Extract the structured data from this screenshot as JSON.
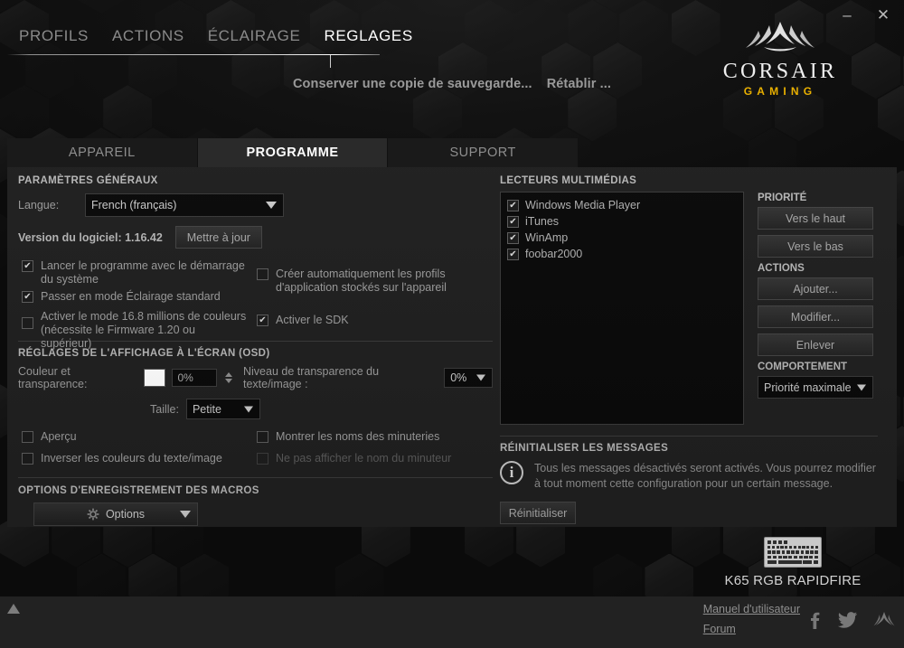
{
  "window": {
    "minimize_label": "–",
    "close_label": "✕"
  },
  "brand": {
    "name": "CORSAIR",
    "tagline": "GAMING"
  },
  "topnav": {
    "items": [
      {
        "label": "PROFILS",
        "active": false
      },
      {
        "label": "ACTIONS",
        "active": false
      },
      {
        "label": "ÉCLAIRAGE",
        "active": false
      },
      {
        "label": "REGLAGES",
        "active": true
      }
    ]
  },
  "subactions": [
    {
      "label": "Conserver une copie de sauvegarde..."
    },
    {
      "label": "Rétablir ..."
    }
  ],
  "tabs": [
    {
      "label": "APPAREIL",
      "active": false
    },
    {
      "label": "PROGRAMME",
      "active": true
    },
    {
      "label": "SUPPORT",
      "active": false
    }
  ],
  "general": {
    "section_title": "PARAMÈTRES GÉNÉRAUX",
    "language_label": "Langue:",
    "language_value": "French (français)",
    "version_label": "Version du logiciel: 1.16.42",
    "update_button": "Mettre à jour",
    "checkboxes": [
      {
        "label": "Lancer le programme avec le démarrage du système",
        "checked": true,
        "disabled": false
      },
      {
        "label": "Créer automatiquement les profils d'application stockés sur l'appareil",
        "checked": false,
        "disabled": false
      },
      {
        "label": "Passer en mode Éclairage standard",
        "checked": true,
        "disabled": false
      },
      {
        "label": "Activer le mode 16.8 millions de couleurs (nécessite le Firmware 1.20 ou supérieur)",
        "checked": false,
        "disabled": false
      },
      {
        "label": "Activer le SDK",
        "checked": true,
        "disabled": false
      }
    ]
  },
  "osd": {
    "section_title": "RÉGLAGES DE L'AFFICHAGE À L'ÉCRAN (OSD)",
    "color_label": "Couleur et transparence:",
    "color_value": "#ffffff",
    "transparency_value": "0%",
    "text_transparency_label": "Niveau de transparence du texte/image :",
    "text_transparency_value": "0%",
    "size_label": "Taille:",
    "size_value": "Petite",
    "checkboxes": [
      {
        "label": "Aperçu",
        "checked": false,
        "disabled": false
      },
      {
        "label": "Montrer les noms des minuteries",
        "checked": false,
        "disabled": false
      },
      {
        "label": "Inverser les couleurs du texte/image",
        "checked": false,
        "disabled": false
      },
      {
        "label": "Ne pas afficher le nom du minuteur",
        "checked": false,
        "disabled": true
      }
    ]
  },
  "macros": {
    "section_title": "OPTIONS D'ENREGISTREMENT DES MACROS",
    "options_button": "Options"
  },
  "media": {
    "section_title": "LECTEURS MULTIMÉDIAS",
    "players": [
      {
        "label": "Windows Media Player",
        "checked": true
      },
      {
        "label": "iTunes",
        "checked": true
      },
      {
        "label": "WinAmp",
        "checked": true
      },
      {
        "label": "foobar2000",
        "checked": true
      }
    ],
    "priority_title": "PRIORITÉ",
    "priority_buttons": [
      "Vers le haut",
      "Vers le bas"
    ],
    "actions_title": "ACTIONS",
    "action_buttons": [
      "Ajouter...",
      "Modifier...",
      "Enlever"
    ],
    "behavior_title": "COMPORTEMENT",
    "behavior_value": "Priorité maximale"
  },
  "reset": {
    "section_title": "RÉINITIALISER LES MESSAGES",
    "description": "Tous les messages désactivés seront activés. Vous pourrez modifier à tout moment cette configuration pour un certain message.",
    "button": "Réinitialiser"
  },
  "device": {
    "name": "K65 RGB RAPIDFIRE"
  },
  "footer": {
    "links": [
      {
        "label": "Manuel d'utilisateur"
      },
      {
        "label": "Forum"
      }
    ],
    "social": [
      "facebook-icon",
      "twitter-icon",
      "corsair-icon"
    ]
  },
  "colors": {
    "accent": "#e9b000",
    "panel": "#202020",
    "text": "#9a9a9a"
  }
}
